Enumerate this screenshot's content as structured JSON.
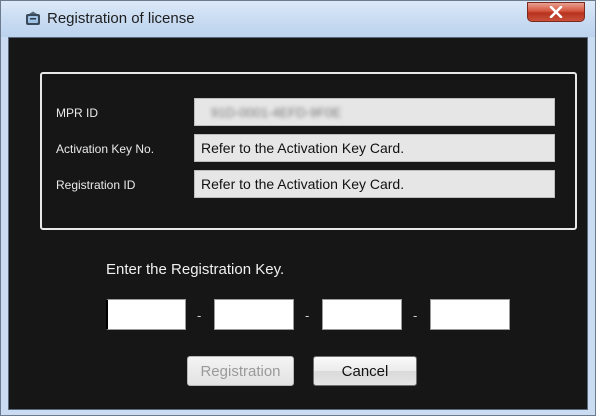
{
  "window": {
    "title": "Registration of license",
    "close_glyph": "x"
  },
  "info": {
    "mpr_id": {
      "label": "MPR ID",
      "value": "91D-0001-4EFD-9F0E"
    },
    "activation_key": {
      "label": "Activation Key No.",
      "value": "Refer to the Activation Key Card."
    },
    "registration_id": {
      "label": "Registration ID",
      "value": "Refer to the Activation Key Card."
    }
  },
  "registration_key": {
    "label": "Enter the Registration Key.",
    "separator": "-",
    "fields": [
      "",
      "",
      "",
      ""
    ]
  },
  "buttons": {
    "registration": "Registration",
    "cancel": "Cancel"
  },
  "icons": {
    "app": "license-app-icon",
    "close": "close-icon"
  }
}
